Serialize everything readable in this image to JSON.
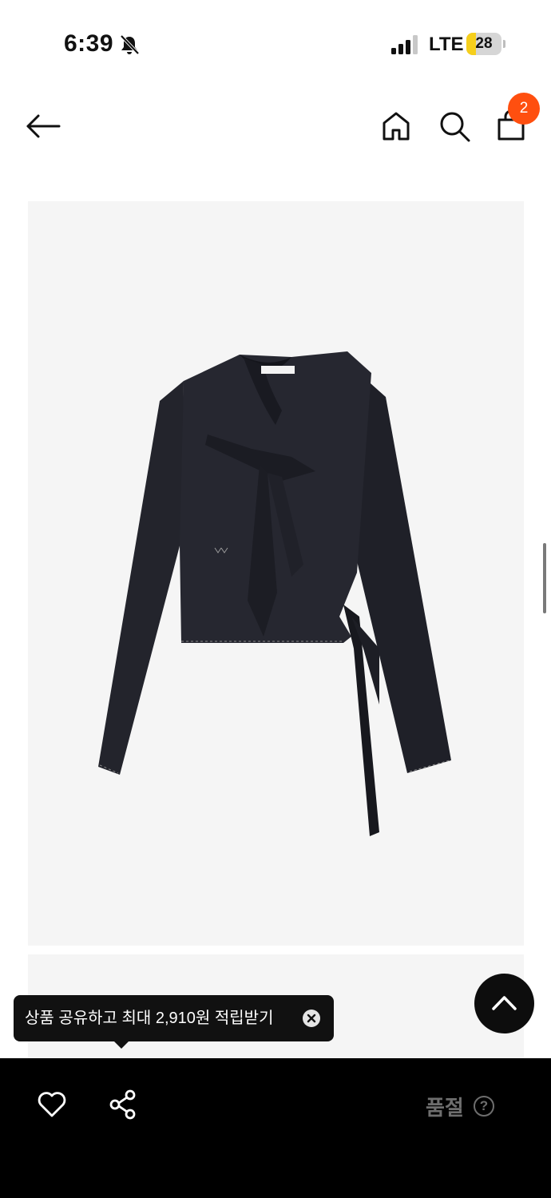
{
  "status_bar": {
    "time": "6:39",
    "network": "LTE",
    "battery": "28",
    "battery_level": 0.28,
    "icons": [
      "bell-slash-icon",
      "signal-icon",
      "battery-icon"
    ]
  },
  "header": {
    "icons": [
      "back-arrow-icon",
      "home-icon",
      "search-icon",
      "cart-icon"
    ],
    "cart_count": "2"
  },
  "tooltip": {
    "text": "상품 공유하고 최대 2,910원 적립받기"
  },
  "bottom_bar": {
    "icons": [
      "heart-icon",
      "share-icon",
      "help-icon"
    ],
    "status_label": "품절",
    "help_symbol": "?"
  },
  "colors": {
    "badge": "#ff4f0f",
    "battery": "#f6cf1c",
    "bottom_bar": "#000000",
    "image_bg": "#f5f5f5"
  }
}
